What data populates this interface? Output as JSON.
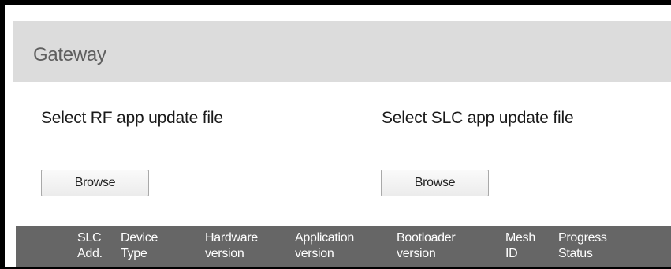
{
  "header": {
    "title": "Gateway"
  },
  "rf": {
    "label": "Select RF app update file",
    "browse_label": "Browse"
  },
  "slc": {
    "label": "Select SLC app update file",
    "browse_label": "Browse"
  },
  "table": {
    "columns": [
      {
        "line1": "SLC",
        "line2": "Add."
      },
      {
        "line1": "Device",
        "line2": "Type"
      },
      {
        "line1": "Hardware",
        "line2": "version"
      },
      {
        "line1": "Application",
        "line2": "version"
      },
      {
        "line1": "Bootloader",
        "line2": "version"
      },
      {
        "line1": "Mesh",
        "line2": "ID"
      },
      {
        "line1": "Progress",
        "line2": "Status"
      }
    ]
  },
  "colors": {
    "header_bg": "#dcdcdc",
    "table_header_bg": "#666666",
    "frame_border": "#000000"
  }
}
